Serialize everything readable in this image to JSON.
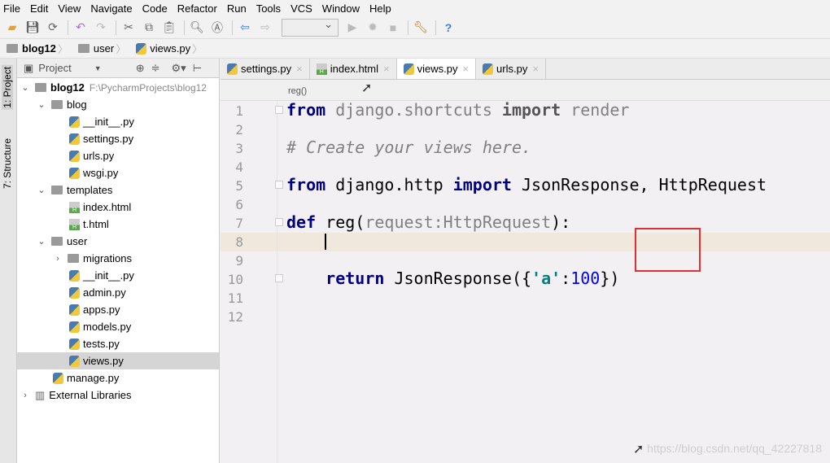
{
  "menu": [
    "File",
    "Edit",
    "View",
    "Navigate",
    "Code",
    "Refactor",
    "Run",
    "Tools",
    "VCS",
    "Window",
    "Help"
  ],
  "breadcrumb": [
    "blog12",
    "user",
    "views.py"
  ],
  "side_tabs": {
    "project": "1: Project",
    "structure": "7: Structure"
  },
  "panel": {
    "title": "Project"
  },
  "tree": [
    {
      "label": "blog12",
      "path": "F:\\PycharmProjects\\blog12",
      "type": "folder",
      "depth": 0,
      "expanded": true
    },
    {
      "label": "blog",
      "type": "folder",
      "depth": 1,
      "expanded": true
    },
    {
      "label": "__init__.py",
      "type": "py",
      "depth": 2
    },
    {
      "label": "settings.py",
      "type": "py",
      "depth": 2
    },
    {
      "label": "urls.py",
      "type": "py",
      "depth": 2
    },
    {
      "label": "wsgi.py",
      "type": "py",
      "depth": 2
    },
    {
      "label": "templates",
      "type": "folder",
      "depth": 1,
      "expanded": true
    },
    {
      "label": "index.html",
      "type": "html",
      "depth": 2
    },
    {
      "label": "t.html",
      "type": "html",
      "depth": 2
    },
    {
      "label": "user",
      "type": "folder",
      "depth": 1,
      "expanded": true
    },
    {
      "label": "migrations",
      "type": "folder",
      "depth": 2,
      "expanded": false
    },
    {
      "label": "__init__.py",
      "type": "py",
      "depth": 2
    },
    {
      "label": "admin.py",
      "type": "py",
      "depth": 2
    },
    {
      "label": "apps.py",
      "type": "py",
      "depth": 2
    },
    {
      "label": "models.py",
      "type": "py",
      "depth": 2
    },
    {
      "label": "tests.py",
      "type": "py",
      "depth": 2
    },
    {
      "label": "views.py",
      "type": "py",
      "depth": 2,
      "selected": true
    },
    {
      "label": "manage.py",
      "type": "py",
      "depth": 1
    },
    {
      "label": "External Libraries",
      "type": "lib",
      "depth": 0,
      "expanded": false
    }
  ],
  "tabs": [
    {
      "label": "settings.py",
      "type": "py"
    },
    {
      "label": "index.html",
      "type": "html"
    },
    {
      "label": "views.py",
      "type": "py",
      "active": true
    },
    {
      "label": "urls.py",
      "type": "py"
    }
  ],
  "editor_breadcrumb": "reg()",
  "code": {
    "l1": {
      "kw1": "from",
      "t1": " django.shortcuts ",
      "kw2": "import",
      "t2": " render"
    },
    "l3": "# Create your views here.",
    "l5": {
      "kw1": "from",
      "t1": " django.http ",
      "kw2": "import",
      "t2": " JsonResponse, HttpRequest"
    },
    "l7": {
      "kw": "def",
      "name": " reg(",
      "param": "request:HttpRequest",
      "end": "):"
    },
    "l10": {
      "indent": "    ",
      "kw": "return",
      "t1": " JsonResponse({",
      "str": "'a'",
      "colon": ":",
      "num": "100",
      "end": "})"
    }
  },
  "line_count": 12,
  "current_line": 8,
  "watermark": "https://blog.csdn.net/qq_42227818",
  "highlight_color": "#e03030"
}
